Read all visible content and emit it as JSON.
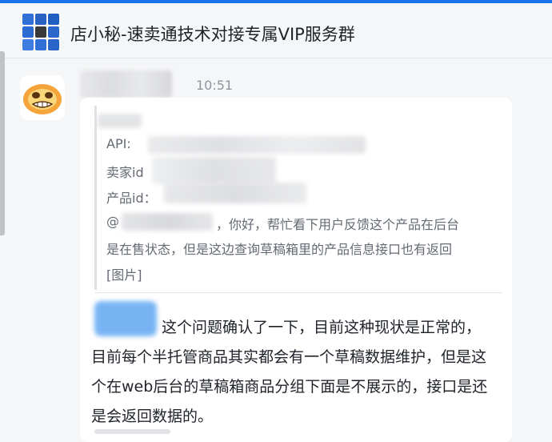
{
  "header": {
    "title": "店小秘-速卖通技术对接专属VIP服务群",
    "group_avatar_colors": [
      "#2f6fd6",
      "#2a62c4",
      "#1f5fbf",
      "#2b6ad2",
      "#3a3a3a",
      "#2a66cc",
      "#3d7de0",
      "#2f6fd6",
      "#2766c8"
    ]
  },
  "message": {
    "timestamp": "10:51",
    "quote": {
      "api_label": "API:",
      "seller_label": "卖家id",
      "product_label": "产品id：",
      "mention_prefix": "@",
      "text_line1": "，你好，帮忙看下用户反馈这个产品在后台",
      "text_line2": "是在售状态，但是这边查询草稿箱里的产品信息接口也有返回",
      "text_line3": "[图片]"
    },
    "reply_text": "这个问题确认了一下，目前这种现状是正常的，目前每个半托管商品其实都会有一个草稿数据维护，但是这个在web后台的草稿箱商品分组下面是不展示的，接口是还是会返回数据的。"
  }
}
